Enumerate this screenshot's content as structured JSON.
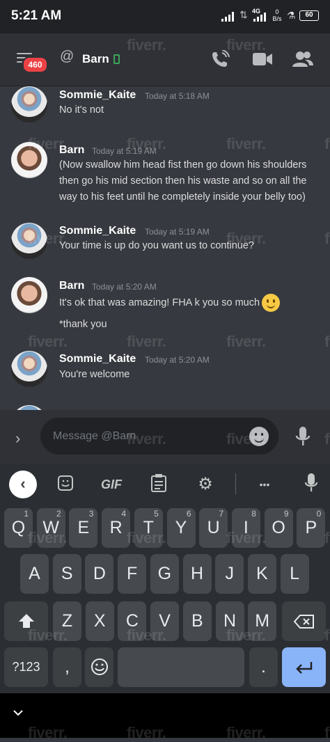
{
  "status_bar": {
    "time": "5:21 AM",
    "network": "4G",
    "data_rate_value": "0",
    "data_rate_unit": "B/s",
    "battery": "60"
  },
  "header": {
    "unread_badge": "460",
    "at_symbol": "@",
    "channel_name": "Barn"
  },
  "messages": [
    {
      "author": "Sommie_Kaite",
      "time": "Today at 5:18 AM",
      "lines": [
        "No it's not"
      ]
    },
    {
      "author": "Barn",
      "time": "Today at 5:19 AM",
      "lines": [
        "(Now swallow him head fist then go down his shoulders then go his mid section then his waste and so on all the way to his feet until he completely inside your belly too)"
      ]
    },
    {
      "author": "Sommie_Kaite",
      "time": "Today at 5:19 AM",
      "lines": [
        "Your time is up do you want us to continue?"
      ]
    },
    {
      "author": "Barn",
      "time": "Today at 5:20 AM",
      "lines": [
        "It's ok that was amazing! FHA k you so much",
        "*thank you"
      ]
    },
    {
      "author": "Sommie_Kaite",
      "time": "Today at 5:20 AM",
      "lines": [
        "You're welcome"
      ]
    }
  ],
  "composer": {
    "expand": "›",
    "placeholder": "Message @Barn"
  },
  "keyboard": {
    "toolbar": {
      "back": "‹",
      "gif": "GIF",
      "more": "•••"
    },
    "row1": [
      {
        "k": "Q",
        "h": "1"
      },
      {
        "k": "W",
        "h": "2"
      },
      {
        "k": "E",
        "h": "3"
      },
      {
        "k": "R",
        "h": "4"
      },
      {
        "k": "T",
        "h": "5"
      },
      {
        "k": "Y",
        "h": "6"
      },
      {
        "k": "U",
        "h": "7"
      },
      {
        "k": "I",
        "h": "8"
      },
      {
        "k": "O",
        "h": "9"
      },
      {
        "k": "P",
        "h": "0"
      }
    ],
    "row2": [
      "A",
      "S",
      "D",
      "F",
      "G",
      "H",
      "J",
      "K",
      "L"
    ],
    "row3": [
      "Z",
      "X",
      "C",
      "V",
      "B",
      "N",
      "M"
    ],
    "row4": {
      "sym": "?123",
      "comma": ",",
      "period": "."
    }
  },
  "watermark": "fiverr."
}
